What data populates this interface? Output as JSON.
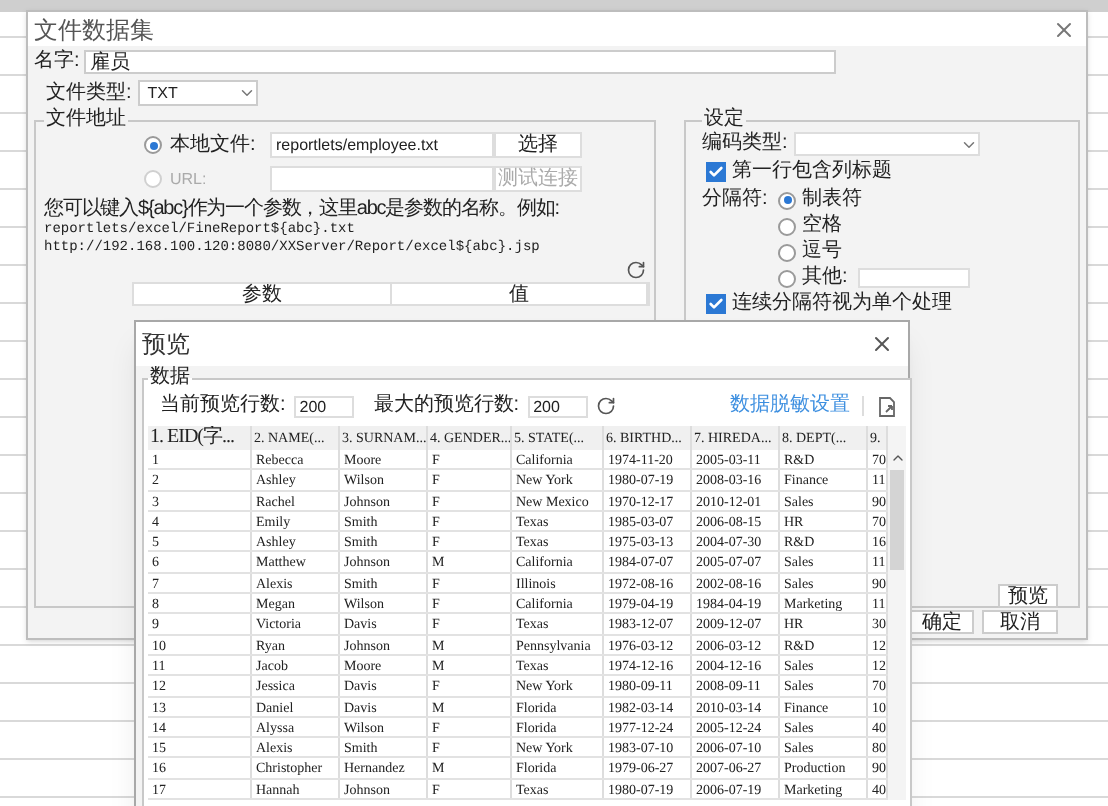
{
  "main_dialog": {
    "title": "文件数据集",
    "name_label": "名字:",
    "name_value": "雇员",
    "file_type_label": "文件类型:",
    "file_type_value": "TXT",
    "file_address": {
      "legend": "文件地址",
      "sources": [
        {
          "label": "本地文件:",
          "selected": true,
          "disabled": false,
          "value": "reportlets/employee.txt",
          "button": "选择"
        },
        {
          "label": "URL:",
          "selected": false,
          "disabled": true,
          "button": "测试连接"
        }
      ],
      "help_lines": [
        "您可以键入${abc}作为一个参数，这里abc是参数的名称。例如:",
        "reportlets/excel/FineReport${abc}.txt",
        "http://192.168.100.120:8080/XXServer/Report/excel${abc}.jsp"
      ],
      "param_columns": [
        "参数",
        "值"
      ]
    },
    "settings": {
      "legend": "设定",
      "encoding_label": "编码类型:",
      "first_row_header": {
        "label": "第一行包含列标题",
        "checked": true
      },
      "delimiter_label": "分隔符:",
      "delimiters": [
        {
          "label": "制表符",
          "selected": true
        },
        {
          "label": "空格",
          "selected": false
        },
        {
          "label": "逗号",
          "selected": false
        },
        {
          "label": "其他:",
          "selected": false,
          "kind": "other"
        }
      ],
      "merge_delimiters": {
        "label": "连续分隔符视为单个处理",
        "checked": true
      }
    },
    "buttons": {
      "preview": "预览",
      "ok": "确定",
      "cancel": "取消"
    }
  },
  "preview_dialog": {
    "title": "预览",
    "legend": "数据",
    "current_rows_label": "当前预览行数:",
    "current_rows_value": "200",
    "max_rows_label": "最大的预览行数:",
    "max_rows_value": "200",
    "masking_link": "数据脱敏设置",
    "columns": [
      "1. EID(字...",
      "2. NAME(...",
      "3. SURNAM...",
      "4. GENDER...",
      "5. STATE(...",
      "6. BIRTHD...",
      "7. HIREDA...",
      "8. DEPT(...",
      "9."
    ],
    "rows": [
      [
        "1",
        "Rebecca",
        "Moore",
        "F",
        "California",
        "1974-11-20",
        "2005-03-11",
        "R&D",
        "70"
      ],
      [
        "2",
        "Ashley",
        "Wilson",
        "F",
        "New York",
        "1980-07-19",
        "2008-03-16",
        "Finance",
        "11"
      ],
      [
        "3",
        "Rachel",
        "Johnson",
        "F",
        "New Mexico",
        "1970-12-17",
        "2010-12-01",
        "Sales",
        "90"
      ],
      [
        "4",
        "Emily",
        "Smith",
        "F",
        "Texas",
        "1985-03-07",
        "2006-08-15",
        "HR",
        "70"
      ],
      [
        "5",
        "Ashley",
        "Smith",
        "F",
        "Texas",
        "1975-03-13",
        "2004-07-30",
        "R&D",
        "16"
      ],
      [
        "6",
        "Matthew",
        "Johnson",
        "M",
        "California",
        "1984-07-07",
        "2005-07-07",
        "Sales",
        "11"
      ],
      [
        "7",
        "Alexis",
        "Smith",
        "F",
        "Illinois",
        "1972-08-16",
        "2002-08-16",
        "Sales",
        "90"
      ],
      [
        "8",
        "Megan",
        "Wilson",
        "F",
        "California",
        "1979-04-19",
        "1984-04-19",
        "Marketing",
        "11"
      ],
      [
        "9",
        "Victoria",
        "Davis",
        "F",
        "Texas",
        "1983-12-07",
        "2009-12-07",
        "HR",
        "30"
      ],
      [
        "10",
        "Ryan",
        "Johnson",
        "M",
        "Pennsylvania",
        "1976-03-12",
        "2006-03-12",
        "R&D",
        "12"
      ],
      [
        "11",
        "Jacob",
        "Moore",
        "M",
        "Texas",
        "1974-12-16",
        "2004-12-16",
        "Sales",
        "12"
      ],
      [
        "12",
        "Jessica",
        "Davis",
        "F",
        "New York",
        "1980-09-11",
        "2008-09-11",
        "Sales",
        "70"
      ],
      [
        "13",
        "Daniel",
        "Davis",
        "M",
        "Florida",
        "1982-03-14",
        "2010-03-14",
        "Finance",
        "10"
      ],
      [
        "14",
        "Alyssa",
        "Wilson",
        "F",
        "Florida",
        "1977-12-24",
        "2005-12-24",
        "Sales",
        "40"
      ],
      [
        "15",
        "Alexis",
        "Smith",
        "F",
        "New York",
        "1983-07-10",
        "2006-07-10",
        "Sales",
        "80"
      ],
      [
        "16",
        "Christopher",
        "Hernandez",
        "M",
        "Florida",
        "1979-06-27",
        "2007-06-27",
        "Production",
        "90"
      ],
      [
        "17",
        "Hannah",
        "Johnson",
        "F",
        "Texas",
        "1980-07-19",
        "2006-07-19",
        "Marketing",
        "40"
      ]
    ]
  }
}
